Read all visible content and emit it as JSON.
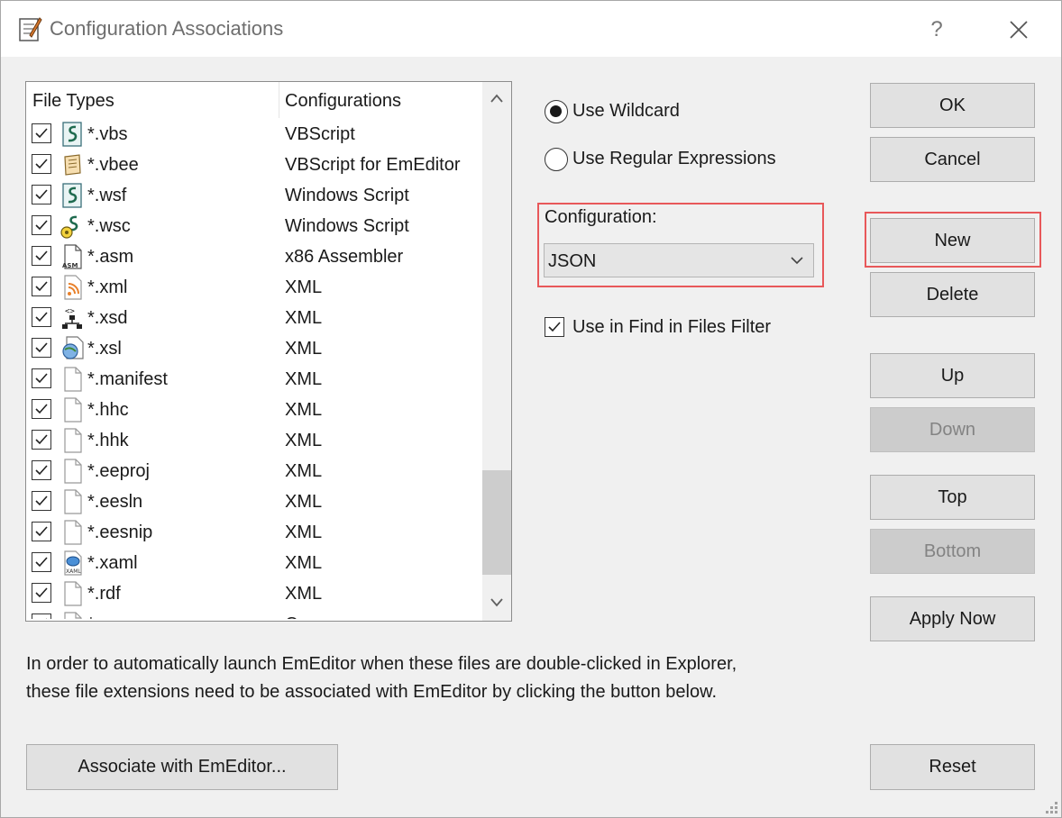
{
  "window": {
    "title": "Configuration Associations",
    "help_glyph": "?",
    "close_icon": "close-icon"
  },
  "list": {
    "columns": [
      "File Types",
      "Configurations"
    ],
    "rows": [
      {
        "ext": "*.vbs",
        "config": "VBScript",
        "icon": "script-icon",
        "checked": true
      },
      {
        "ext": "*.vbee",
        "config": "VBScript for EmEditor",
        "icon": "scroll-icon",
        "checked": true
      },
      {
        "ext": "*.wsf",
        "config": "Windows Script",
        "icon": "script-icon",
        "checked": true
      },
      {
        "ext": "*.wsc",
        "config": "Windows Script",
        "icon": "script-component-icon",
        "checked": true
      },
      {
        "ext": "*.asm",
        "config": "x86 Assembler",
        "icon": "asm-file-icon",
        "checked": true
      },
      {
        "ext": "*.xml",
        "config": "XML",
        "icon": "rss-file-icon",
        "checked": true
      },
      {
        "ext": "*.xsd",
        "config": "XML",
        "icon": "schema-tree-icon",
        "checked": true
      },
      {
        "ext": "*.xsl",
        "config": "XML",
        "icon": "xsl-file-icon",
        "checked": true
      },
      {
        "ext": "*.manifest",
        "config": "XML",
        "icon": "blank-file-icon",
        "checked": true
      },
      {
        "ext": "*.hhc",
        "config": "XML",
        "icon": "blank-file-icon",
        "checked": true
      },
      {
        "ext": "*.hhk",
        "config": "XML",
        "icon": "blank-file-icon",
        "checked": true
      },
      {
        "ext": "*.eeproj",
        "config": "XML",
        "icon": "blank-file-icon",
        "checked": true
      },
      {
        "ext": "*.eesln",
        "config": "XML",
        "icon": "blank-file-icon",
        "checked": true
      },
      {
        "ext": "*.eesnip",
        "config": "XML",
        "icon": "blank-file-icon",
        "checked": true
      },
      {
        "ext": "*.xaml",
        "config": "XML",
        "icon": "xaml-file-icon",
        "checked": true
      },
      {
        "ext": "*.rdf",
        "config": "XML",
        "icon": "blank-file-icon",
        "checked": true
      },
      {
        "ext": "*.",
        "config": "C",
        "icon": "blank-file-icon",
        "checked": true
      }
    ]
  },
  "options": {
    "use_wildcard": "Use Wildcard",
    "use_regex": "Use Regular Expressions",
    "selected": "use_wildcard",
    "configuration_label": "Configuration:",
    "configuration_value": "JSON",
    "use_in_find_label": "Use in Find in Files Filter",
    "use_in_find_checked": true
  },
  "buttons": {
    "ok": "OK",
    "cancel": "Cancel",
    "new": "New",
    "delete": "Delete",
    "up": "Up",
    "down": "Down",
    "top": "Top",
    "bottom": "Bottom",
    "apply_now": "Apply Now",
    "reset": "Reset",
    "associate": "Associate with EmEditor..."
  },
  "info": {
    "line1": "In order to automatically launch EmEditor when these files are double-clicked in Explorer,",
    "line2": "these file extensions need to be associated with EmEditor by clicking the button below."
  },
  "colors": {
    "highlight": "#e8585a",
    "dialog_bg": "#f0f0f0",
    "button_bg": "#e1e1e1",
    "disabled_text": "#838383"
  }
}
